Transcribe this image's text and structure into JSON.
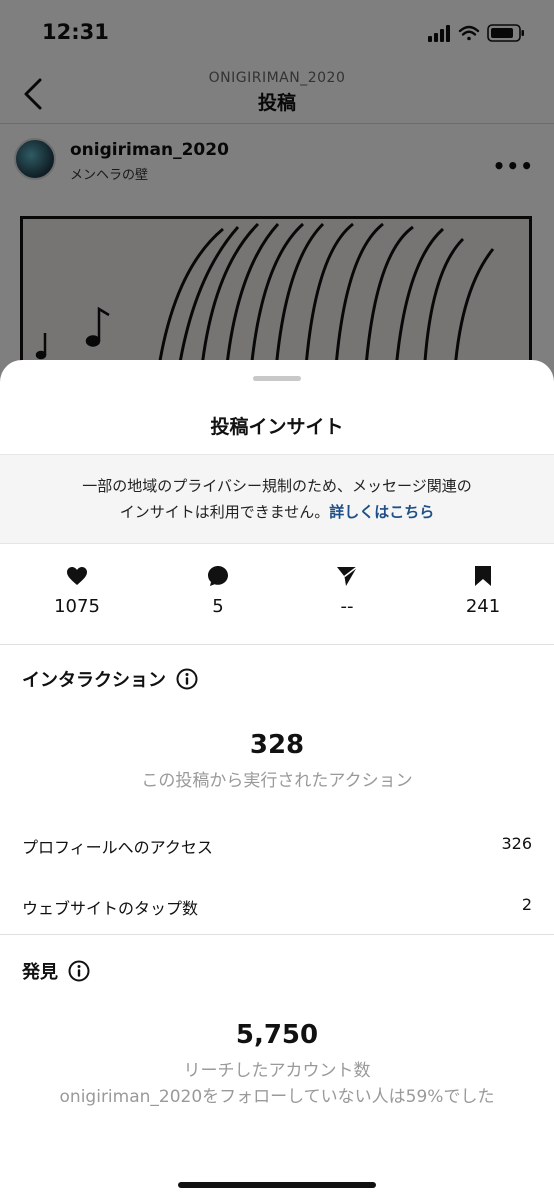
{
  "status_bar": {
    "time": "12:31"
  },
  "header": {
    "subtitle": "ONIGIRIMAN_2020",
    "title": "投稿"
  },
  "post": {
    "username": "onigiriman_2020",
    "location": "メンヘラの壁"
  },
  "sheet": {
    "title": "投稿インサイト",
    "notice": {
      "text": "一部の地域のプライバシー規制のため、メッセージ関連の",
      "text2": "インサイトは利用できません。",
      "link": "詳しくはこちら"
    },
    "stats": [
      {
        "icon": "heart-icon",
        "value": "1075"
      },
      {
        "icon": "comment-icon",
        "value": "5"
      },
      {
        "icon": "send-icon",
        "value": "--"
      },
      {
        "icon": "bookmark-icon",
        "value": "241"
      }
    ],
    "interactions": {
      "title": "インタラクション",
      "total": "328",
      "total_label": "この投稿から実行されたアクション",
      "rows": [
        {
          "label": "プロフィールへのアクセス",
          "value": "326"
        },
        {
          "label": "ウェブサイトのタップ数",
          "value": "2"
        }
      ]
    },
    "discovery": {
      "title": "発見",
      "total": "5,750",
      "total_label": "リーチしたアカウント数",
      "followers_note": "onigiriman_2020をフォローしていない人は59%でした"
    }
  }
}
